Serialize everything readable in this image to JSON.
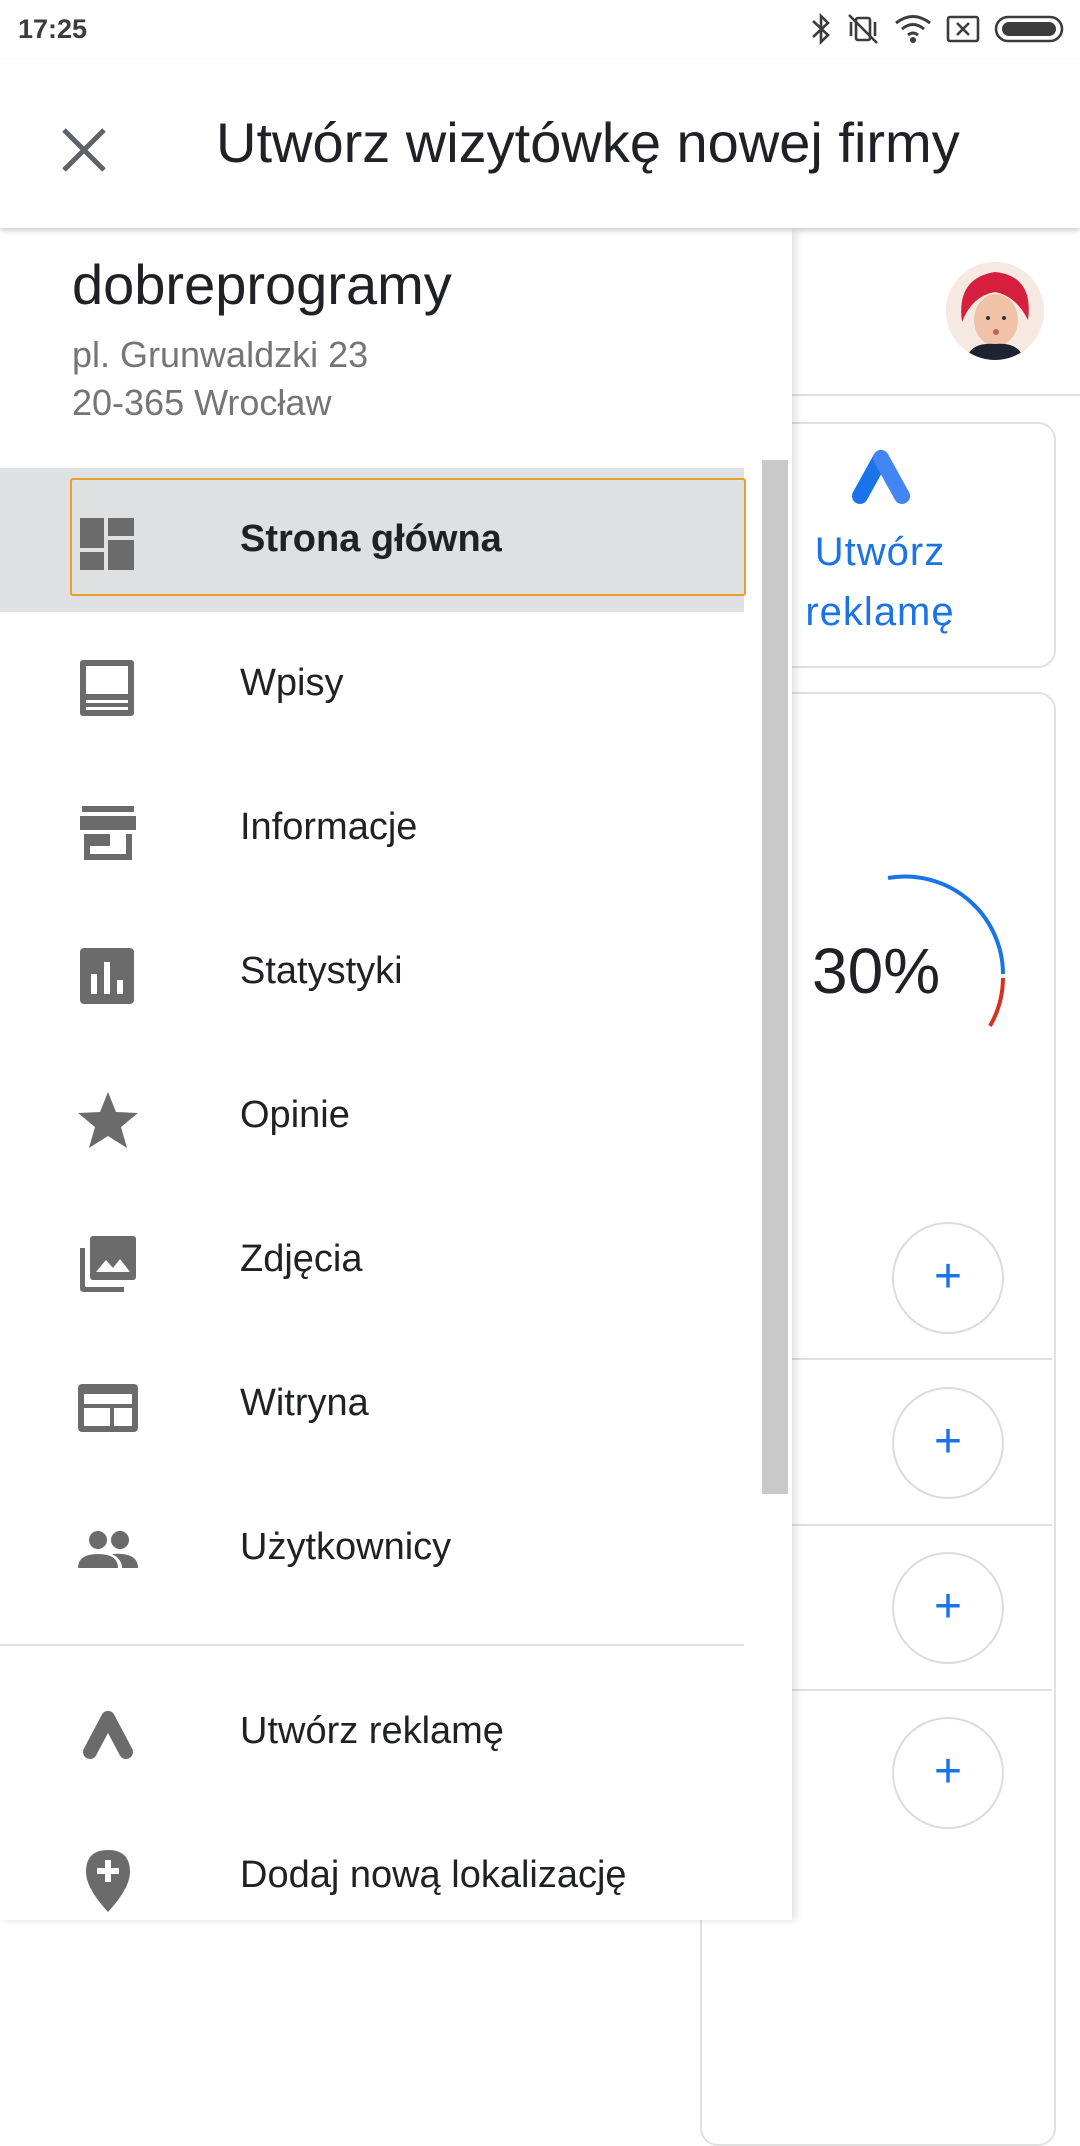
{
  "status_bar": {
    "time": "17:25",
    "icons": [
      "bluetooth-icon",
      "vibrate-off-icon",
      "wifi-icon",
      "no-sim-icon",
      "battery-icon"
    ]
  },
  "app_bar": {
    "title": "Utwórz wizytówkę nowej firmy",
    "close_icon": "close-icon"
  },
  "drawer": {
    "business_name": "dobreprogramy",
    "address_line1": "pl. Grunwaldzki 23",
    "address_line2": "20-365 Wrocław",
    "items": [
      {
        "label": "Strona główna",
        "icon": "dashboard-icon",
        "active": true
      },
      {
        "label": "Wpisy",
        "icon": "posts-icon"
      },
      {
        "label": "Informacje",
        "icon": "store-icon"
      },
      {
        "label": "Statystyki",
        "icon": "bar-chart-icon"
      },
      {
        "label": "Opinie",
        "icon": "star-icon"
      },
      {
        "label": "Zdjęcia",
        "icon": "photos-icon"
      },
      {
        "label": "Witryna",
        "icon": "website-icon"
      },
      {
        "label": "Użytkownicy",
        "icon": "people-icon"
      }
    ],
    "secondary_items": [
      {
        "label": "Utwórz reklamę",
        "icon": "google-ads-icon"
      },
      {
        "label": "Dodaj nową lokalizację",
        "icon": "add-location-icon"
      }
    ]
  },
  "background": {
    "ad_card_label": "Utwórz reklamę",
    "progress_text": "30%",
    "progress_value": 0.3,
    "plus_symbol": "+"
  },
  "colors": {
    "accent": "#1a73e8",
    "icon_gray": "#6b6b6b",
    "active_bg": "#dfe0e2",
    "focus_ring": "#e89f2c",
    "arc_red": "#d93025"
  }
}
